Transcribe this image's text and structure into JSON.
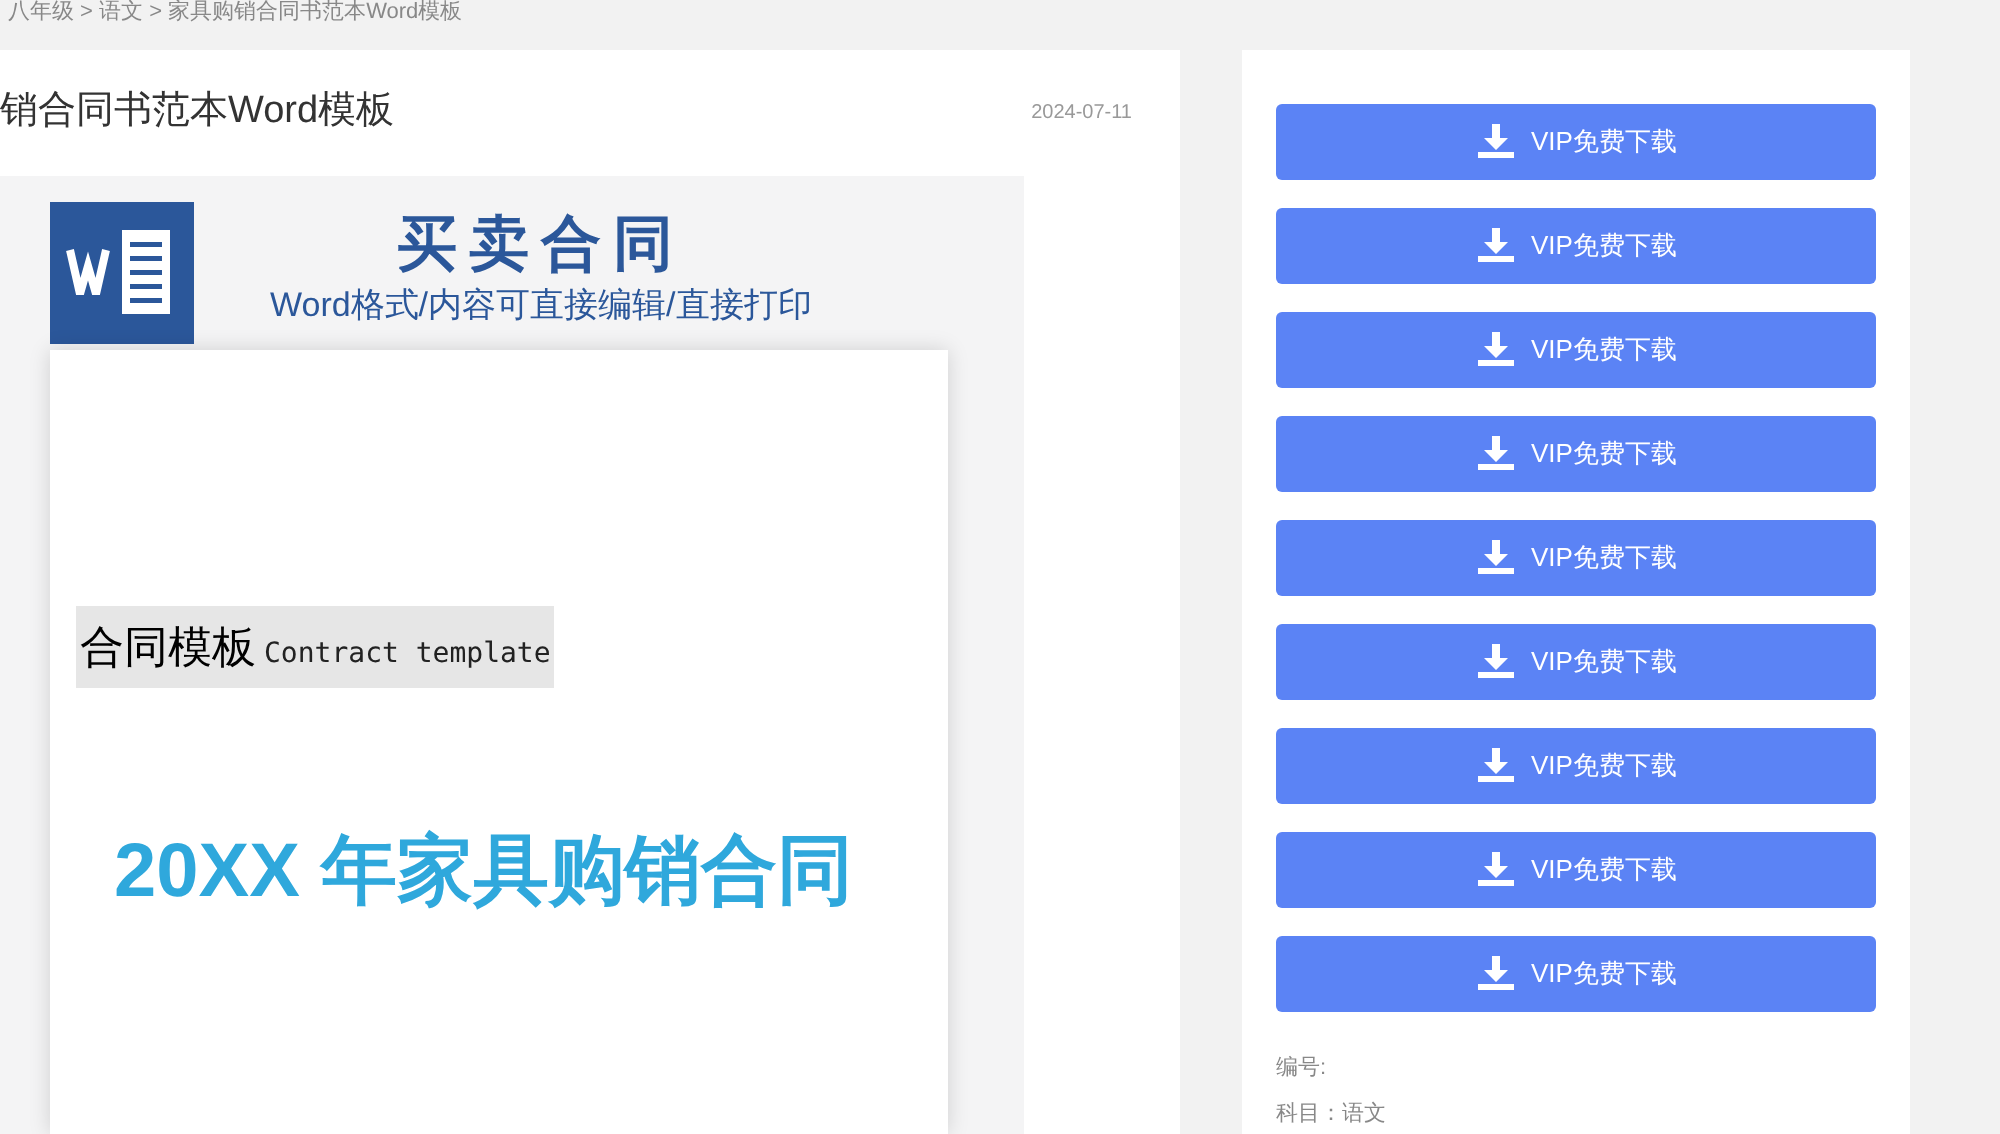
{
  "breadcrumb": "八年级 > 语文 > 家具购销合同书范本Word模板",
  "article": {
    "title": "销合同书范本Word模板",
    "date": "2024-07-11",
    "preview": {
      "heading": "买卖合同",
      "subheading": "Word格式/内容可直接编辑/直接打印",
      "label_cn": "合同模板",
      "label_en": "Contract template",
      "doc_title": "20XX 年家具购销合同"
    }
  },
  "sidebar": {
    "buttons": [
      {
        "label": "VIP免费下载"
      },
      {
        "label": "VIP免费下载"
      },
      {
        "label": "VIP免费下载"
      },
      {
        "label": "VIP免费下载"
      },
      {
        "label": "VIP免费下载"
      },
      {
        "label": "VIP免费下载"
      },
      {
        "label": "VIP免费下载"
      },
      {
        "label": "VIP免费下载"
      },
      {
        "label": "VIP免费下载"
      }
    ],
    "info": [
      "编号:",
      "科目：语文"
    ]
  }
}
